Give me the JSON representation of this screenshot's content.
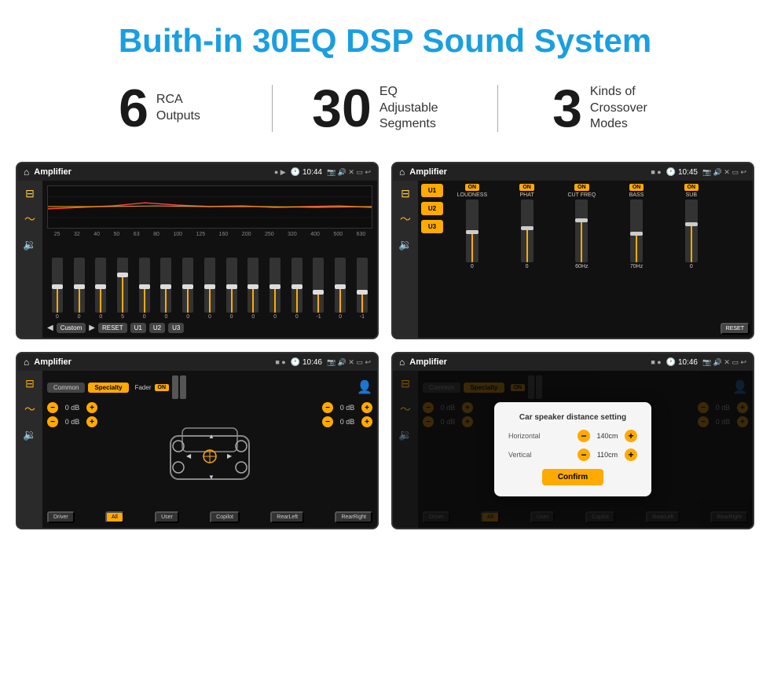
{
  "page": {
    "title": "Buith-in 30EQ DSP Sound System"
  },
  "stats": [
    {
      "number": "6",
      "label": "RCA\nOutputs"
    },
    {
      "number": "30",
      "label": "EQ Adjustable\nSegments"
    },
    {
      "number": "3",
      "label": "Kinds of\nCrossover Modes"
    }
  ],
  "screens": [
    {
      "id": "screen1",
      "statusBar": {
        "appName": "Amplifier",
        "time": "10:44"
      },
      "type": "eq"
    },
    {
      "id": "screen2",
      "statusBar": {
        "appName": "Amplifier",
        "time": "10:45"
      },
      "type": "amp"
    },
    {
      "id": "screen3",
      "statusBar": {
        "appName": "Amplifier",
        "time": "10:46"
      },
      "type": "fader"
    },
    {
      "id": "screen4",
      "statusBar": {
        "appName": "Amplifier",
        "time": "10:46"
      },
      "type": "fader-dialog"
    }
  ],
  "eq": {
    "frequencies": [
      "25",
      "32",
      "40",
      "50",
      "63",
      "80",
      "100",
      "125",
      "160",
      "200",
      "250",
      "320",
      "400",
      "500",
      "630"
    ],
    "values": [
      "0",
      "0",
      "0",
      "5",
      "0",
      "0",
      "0",
      "0",
      "0",
      "0",
      "0",
      "0",
      "-1",
      "0",
      "-1"
    ],
    "buttons": [
      "Custom",
      "RESET",
      "U1",
      "U2",
      "U3"
    ]
  },
  "amp": {
    "presets": [
      "U1",
      "U2",
      "U3"
    ],
    "controls": [
      "LOUDNESS",
      "PHAT",
      "CUT FREQ",
      "BASS",
      "SUB"
    ],
    "resetLabel": "RESET"
  },
  "fader": {
    "tabs": [
      "Common",
      "Specialty"
    ],
    "faderLabel": "Fader",
    "onLabel": "ON",
    "dbValues": [
      "0 dB",
      "0 dB",
      "0 dB",
      "0 dB"
    ],
    "zones": [
      "Driver",
      "Copilot",
      "RearLeft",
      "RearRight"
    ],
    "allLabel": "All",
    "userLabel": "User",
    "confirmLabel": "Confirm",
    "dialog": {
      "title": "Car speaker distance setting",
      "horizontal": {
        "label": "Horizontal",
        "value": "140cm"
      },
      "vertical": {
        "label": "Vertical",
        "value": "110cm"
      },
      "confirmLabel": "Confirm"
    }
  }
}
